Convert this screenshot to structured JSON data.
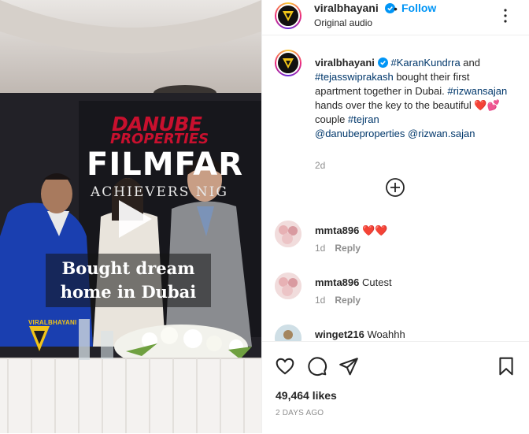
{
  "media": {
    "overlay_line1": "Bought dream",
    "overlay_line2": "home in Dubai",
    "watermark": "VIRALBHAYANI",
    "brand_line1": "DANUBE",
    "brand_line2": "PROPERTIES",
    "brand_event": "FILMFAR",
    "brand_event_sub": "ACHIEVERS NIG",
    "play_icon": "play-icon"
  },
  "header": {
    "username": "viralbhayani",
    "dot": "•",
    "follow_label": "Follow",
    "audio": "Original audio",
    "more_icon": "more-icon"
  },
  "caption": {
    "username": "viralbhayani",
    "parts": {
      "t1": "#KaranKundrra",
      "p1": " and ",
      "t2": "#tejasswiprakash",
      "p2": " bought their first apartment together in Dubai. ",
      "t3": "#rizwansajan",
      "p3": " hands over the key to the beautiful ",
      "hearts": "❤️💕",
      "p4": " couple ",
      "t4": "#tejran",
      "t5": "@danubeproperties",
      "t6": "@rizwan.sajan"
    },
    "time": "2d"
  },
  "comments": [
    {
      "username": "mmta896",
      "text": "❤️❤️",
      "time": "1d",
      "reply": "Reply"
    },
    {
      "username": "mmta896",
      "text": "Cutest",
      "time": "1d",
      "reply": "Reply"
    },
    {
      "username": "winget216",
      "text": "Woahhh"
    }
  ],
  "actions": {
    "likes": "49,464 likes",
    "date": "2 DAYS AGO"
  },
  "colors": {
    "accent_blue": "#0095f6",
    "tag_blue": "#00376b",
    "heart_red": "#ed4956",
    "muted": "#8e8e8e"
  }
}
